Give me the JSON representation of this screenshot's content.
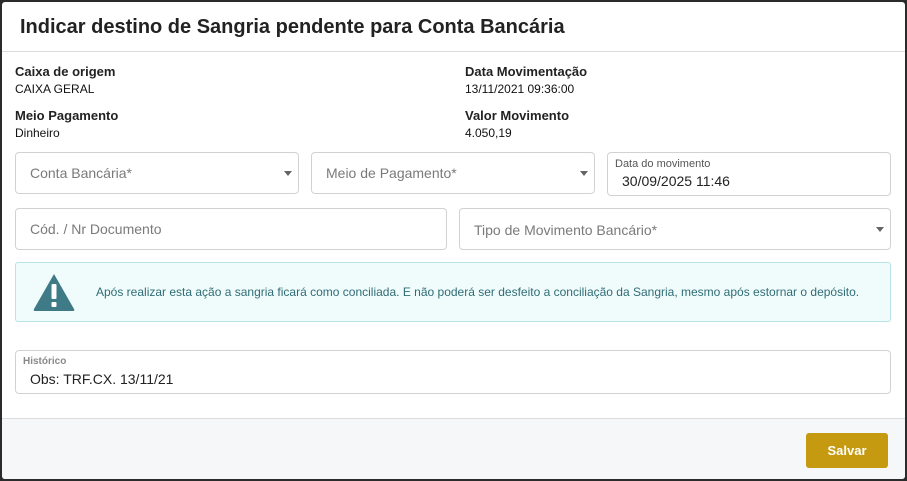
{
  "dialog": {
    "title": "Indicar destino de Sangria pendente para Conta Bancária"
  },
  "info": {
    "caixa_origem": {
      "label": "Caixa de origem",
      "value": "CAIXA GERAL"
    },
    "data_movimentacao": {
      "label": "Data Movimentação",
      "value": "13/11/2021 09:36:00"
    },
    "meio_pagamento": {
      "label": "Meio Pagamento",
      "value": "Dinheiro"
    },
    "valor_movimento": {
      "label": "Valor Movimento",
      "value": "4.050,19"
    }
  },
  "form": {
    "conta_bancaria": {
      "placeholder": "Conta Bancária*"
    },
    "meio_de_pagamento": {
      "placeholder": "Meio de Pagamento*"
    },
    "data_do_movimento": {
      "label": "Data do movimento",
      "value": "30/09/2025 11:46"
    },
    "documento": {
      "placeholder": "Cód. / Nr Documento"
    },
    "tipo_movimento": {
      "placeholder": "Tipo de Movimento Bancário*"
    },
    "historico": {
      "label": "Histórico",
      "value": "Obs: TRF.CX. 13/11/21"
    }
  },
  "alert": {
    "icon": "warning-triangle-icon",
    "message": "Após realizar esta ação a sangria ficará como conciliada. E não poderá ser desfeito a conciliação da Sangria, mesmo após estornar o depósito."
  },
  "footer": {
    "save_label": "Salvar",
    "save_color": "#c59a10"
  }
}
